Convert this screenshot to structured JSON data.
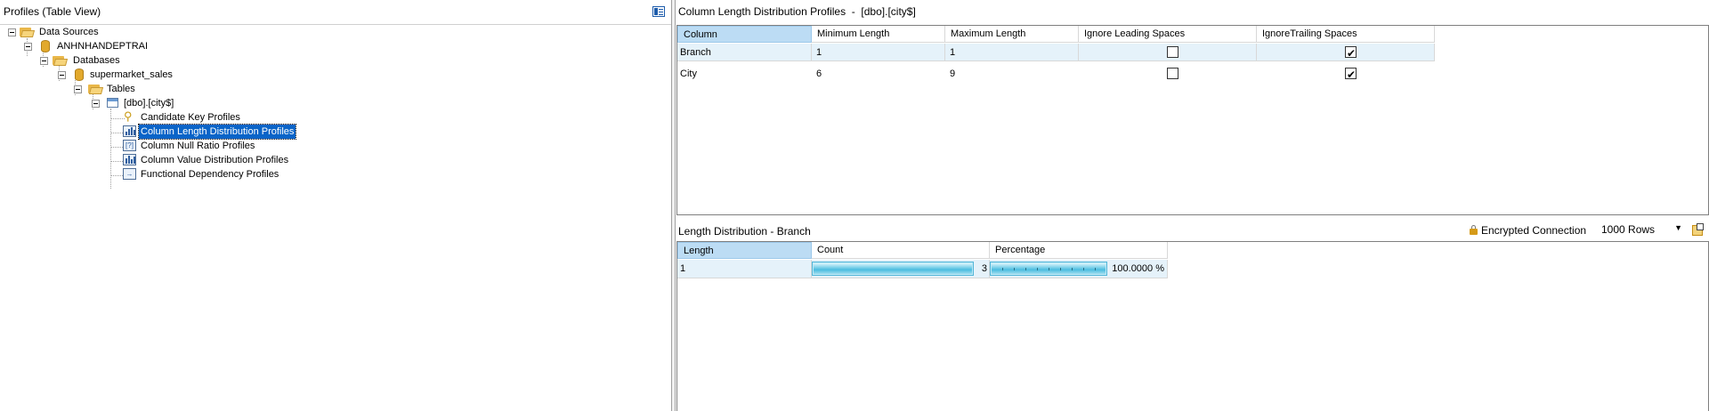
{
  "left_pane": {
    "title": "Profiles (Table View)",
    "tree": {
      "data_sources": "Data Sources",
      "server": "ANHNHANDEPTRAI",
      "databases": "Databases",
      "database": "supermarket_sales",
      "tables": "Tables",
      "table": "[dbo].[city$]",
      "profiles": [
        {
          "label": "Candidate Key Profiles",
          "icon": "key-icon",
          "selected": false
        },
        {
          "label": "Column Length Distribution Profiles",
          "icon": "bar-chart-icon",
          "selected": true
        },
        {
          "label": "Column Null Ratio Profiles",
          "icon": "null-ratio-icon",
          "selected": false
        },
        {
          "label": "Column Value Distribution Profiles",
          "icon": "bar-chart-icon",
          "selected": false
        },
        {
          "label": "Functional Dependency Profiles",
          "icon": "dependency-icon",
          "selected": false
        }
      ]
    }
  },
  "right_pane": {
    "title": "Column Length Distribution Profiles  -  [dbo].[city$]",
    "columns_grid": {
      "headers": [
        "Column",
        "Minimum Length",
        "Maximum Length",
        "Ignore Leading Spaces",
        "IgnoreTrailing Spaces"
      ],
      "rows": [
        {
          "column": "Branch",
          "min": "1",
          "max": "1",
          "ignore_leading": false,
          "ignore_trailing": true
        },
        {
          "column": "City",
          "min": "6",
          "max": "9",
          "ignore_leading": false,
          "ignore_trailing": true
        }
      ]
    },
    "distribution": {
      "title": "Length Distribution - Branch",
      "encrypted_label": "Encrypted Connection",
      "rows_option": "1000 Rows",
      "headers": [
        "Length",
        "Count",
        "Percentage"
      ],
      "rows": [
        {
          "length": "1",
          "count": "3",
          "count_fraction": 1.0,
          "percentage": "100.0000 %",
          "percentage_fraction": 1.0
        }
      ]
    }
  }
}
